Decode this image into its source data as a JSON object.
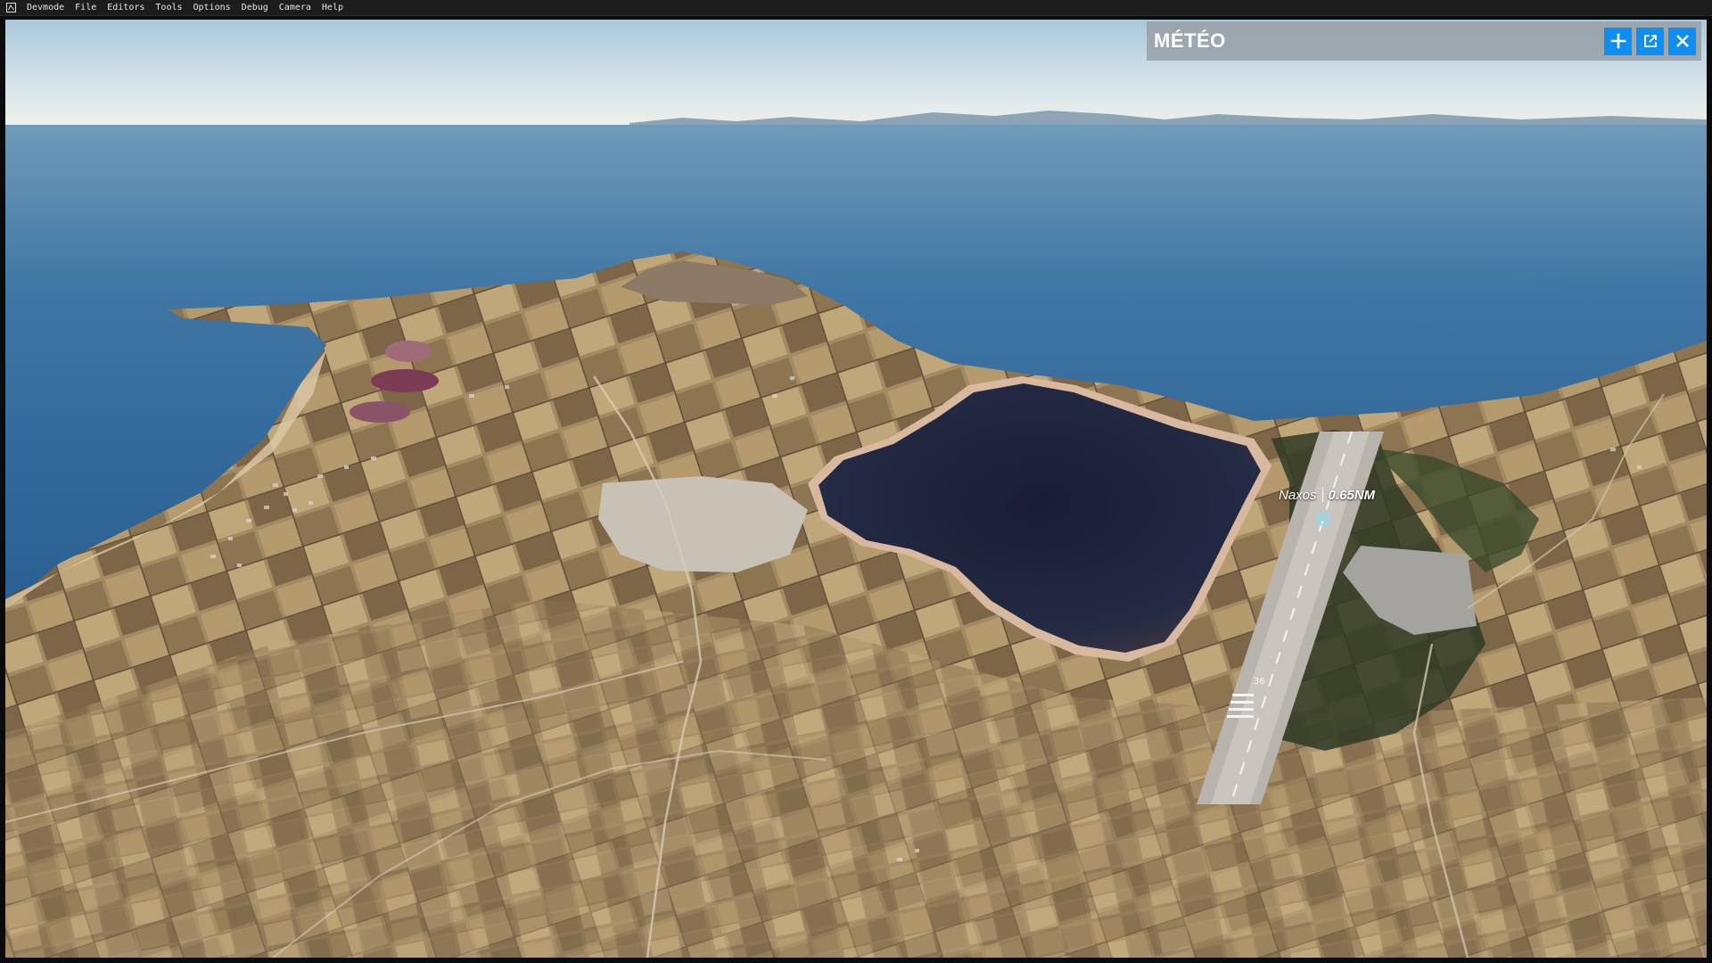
{
  "app": {
    "icon": "devmode-icon",
    "menu": [
      "Devmode",
      "File",
      "Editors",
      "Tools",
      "Options",
      "Debug",
      "Camera",
      "Help"
    ]
  },
  "weather_panel": {
    "title": "MÉTÉO",
    "buttons": [
      {
        "icon": "plus-icon"
      },
      {
        "icon": "popout-icon"
      },
      {
        "icon": "close-icon"
      }
    ],
    "accent_color": "#0d8ef0"
  },
  "airport_marker": {
    "name": "Naxos",
    "distance": "0.65NM",
    "icon": "airport-marker-icon"
  },
  "runway": {
    "number": "36"
  }
}
